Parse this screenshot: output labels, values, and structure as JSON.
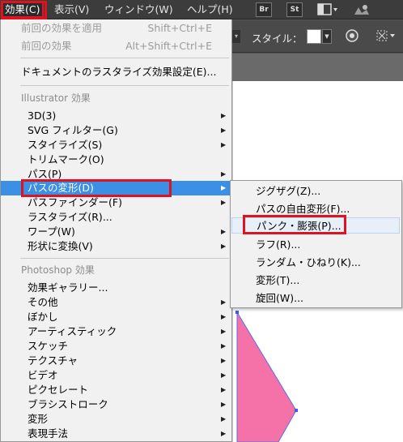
{
  "menubar": {
    "items": [
      "効果(C)",
      "表示(V)",
      "ウィンドウ(W)",
      "ヘルプ(H)"
    ],
    "buttons": [
      "Br",
      "St"
    ]
  },
  "control_bar": {
    "style_label": "スタイル："
  },
  "effect_menu": {
    "apply_last": "前回の効果を適用",
    "apply_last_shortcut": "Shift+Ctrl+E",
    "last_effect": "前回の効果",
    "last_effect_shortcut": "Alt+Shift+Ctrl+E",
    "doc_raster_settings": "ドキュメントのラスタライズ効果設定(E)...",
    "illustrator_header": "Illustrator 効果",
    "illustrator_items": [
      "3D(3)",
      "SVG フィルター(G)",
      "スタイライズ(S)",
      "トリムマーク(O)",
      "パス(P)",
      "パスの変形(D)",
      "パスファインダー(F)",
      "ラスタライズ(R)...",
      "ワープ(W)",
      "形状に変換(V)"
    ],
    "photoshop_header": "Photoshop 効果",
    "photoshop_items": [
      "効果ギャラリー...",
      "その他",
      "ぼかし",
      "アーティスティック",
      "スケッチ",
      "テクスチャ",
      "ビデオ",
      "ピクセレート",
      "ブラシストローク",
      "変形",
      "表現手法"
    ]
  },
  "distort_submenu": {
    "items": [
      "ジグザグ(Z)...",
      "パスの自由変形(F)...",
      "パンク・膨張(P)...",
      "ラフ(R)...",
      "ランダム・ひねり(K)...",
      "変形(T)...",
      "旋回(W)..."
    ]
  },
  "colors": {
    "selection": "#3b8fe5",
    "highlight_box": "#e0121d",
    "shape_fill": "#f472a8",
    "shape_stroke": "#5a6ee8"
  }
}
